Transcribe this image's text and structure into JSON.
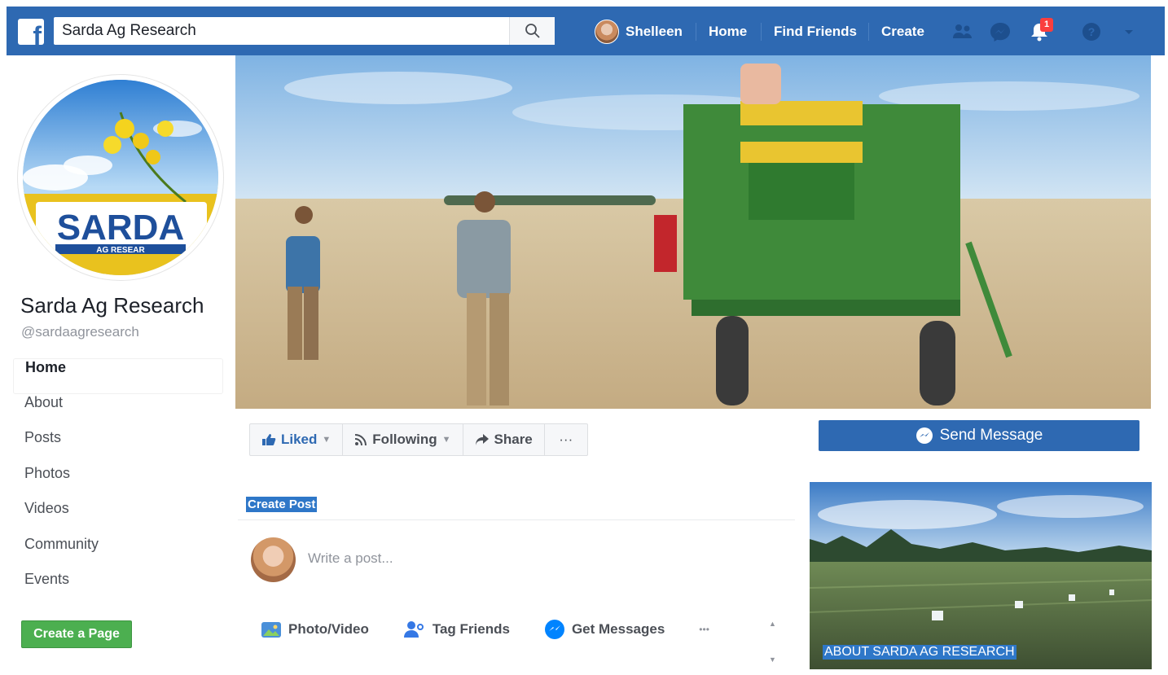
{
  "app": {
    "logo": "f",
    "colors": {
      "brand": "#2e69b2",
      "notification": "#fa3e3e",
      "create_page": "#4caf50"
    }
  },
  "topbar": {
    "search_value": "Sarda Ag Research",
    "search_icon": "search-icon",
    "user_name": "Shelleen",
    "home": "Home",
    "find_friends": "Find Friends",
    "create": "Create",
    "notification_count": "1",
    "icons": [
      "friend-requests-icon",
      "messenger-icon",
      "notifications-icon",
      "help-icon",
      "caret-down-icon"
    ]
  },
  "page": {
    "logo_text": "SARDA",
    "logo_subtext": "AG RESEAR",
    "name": "Sarda Ag Research",
    "handle": "@sardaagresearch"
  },
  "sidebar": {
    "items": [
      {
        "label": "Home",
        "active": true
      },
      {
        "label": "About"
      },
      {
        "label": "Posts"
      },
      {
        "label": "Photos"
      },
      {
        "label": "Videos"
      },
      {
        "label": "Community"
      },
      {
        "label": "Events"
      }
    ],
    "create_page": "Create a Page"
  },
  "actions": {
    "liked": "Liked",
    "following": "Following",
    "share": "Share",
    "more": "···",
    "send_message": "Send Message"
  },
  "composer": {
    "title": "Create Post",
    "placeholder": "Write a post...",
    "options": [
      {
        "label": "Photo/Video",
        "icon": "photo-icon"
      },
      {
        "label": "Tag Friends",
        "icon": "tag-friends-icon"
      },
      {
        "label": "Get Messages",
        "icon": "messenger-icon"
      }
    ],
    "more": "•••"
  },
  "about": {
    "label": "ABOUT SARDA AG RESEARCH"
  }
}
